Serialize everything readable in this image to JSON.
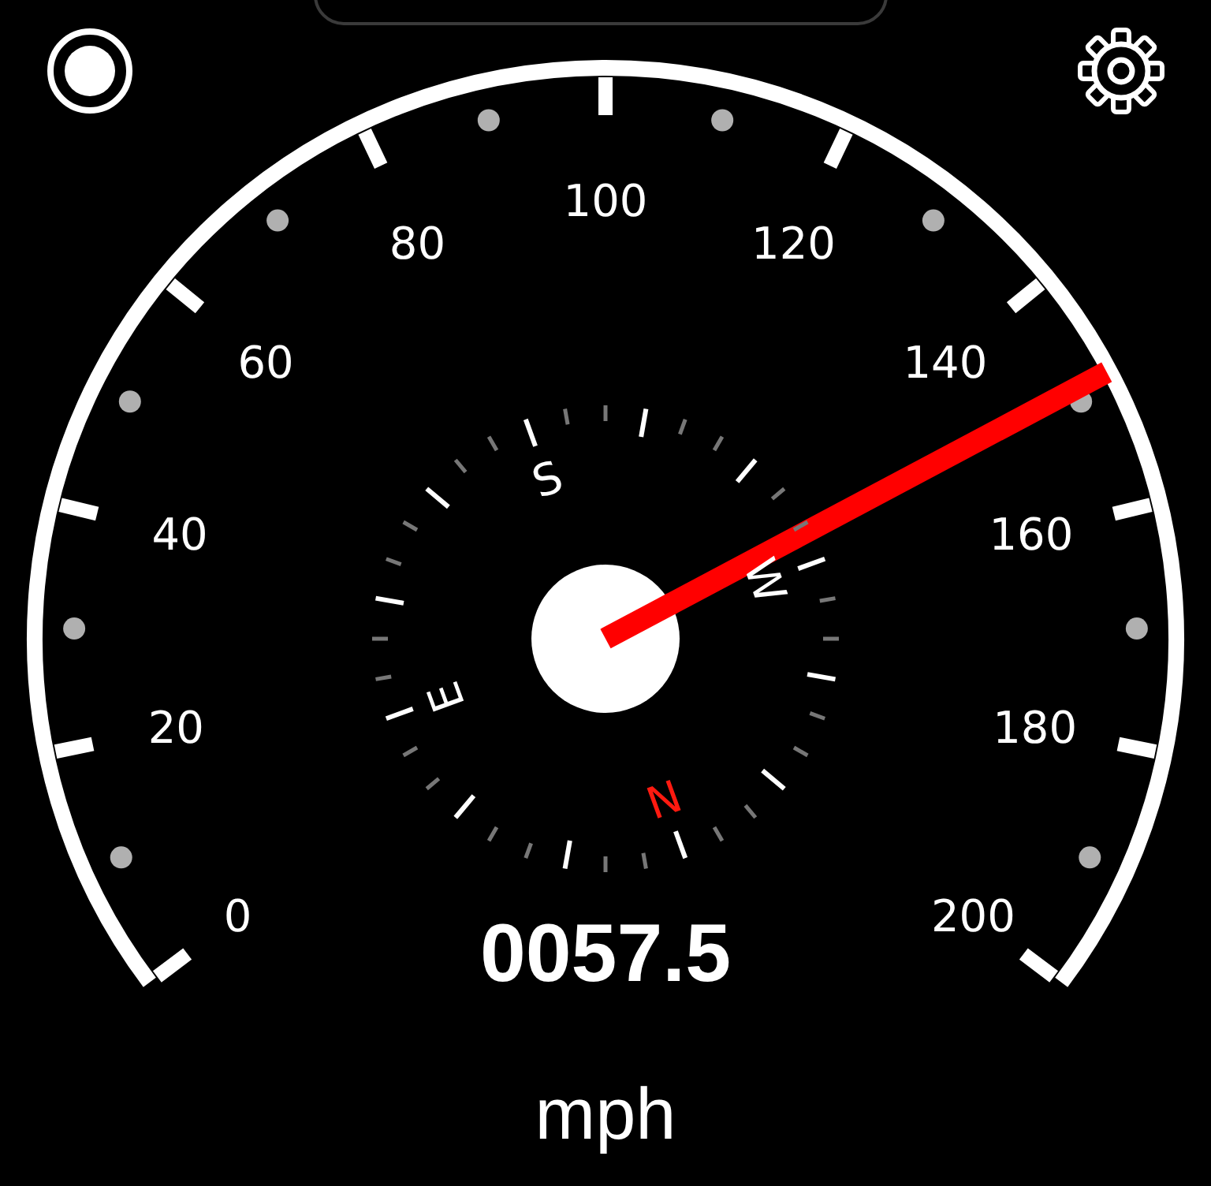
{
  "gauge": {
    "scale_labels": [
      "0",
      "20",
      "40",
      "60",
      "80",
      "100",
      "120",
      "140",
      "160",
      "180",
      "200"
    ]
  },
  "compass": {
    "letters": [
      {
        "text": "N",
        "color": "#ff1a10"
      },
      {
        "text": "E",
        "color": "#ffffff"
      },
      {
        "text": "S",
        "color": "#ffffff"
      },
      {
        "text": "W",
        "color": "#ffffff"
      }
    ]
  },
  "readout": "0057.5",
  "unit": "mph"
}
